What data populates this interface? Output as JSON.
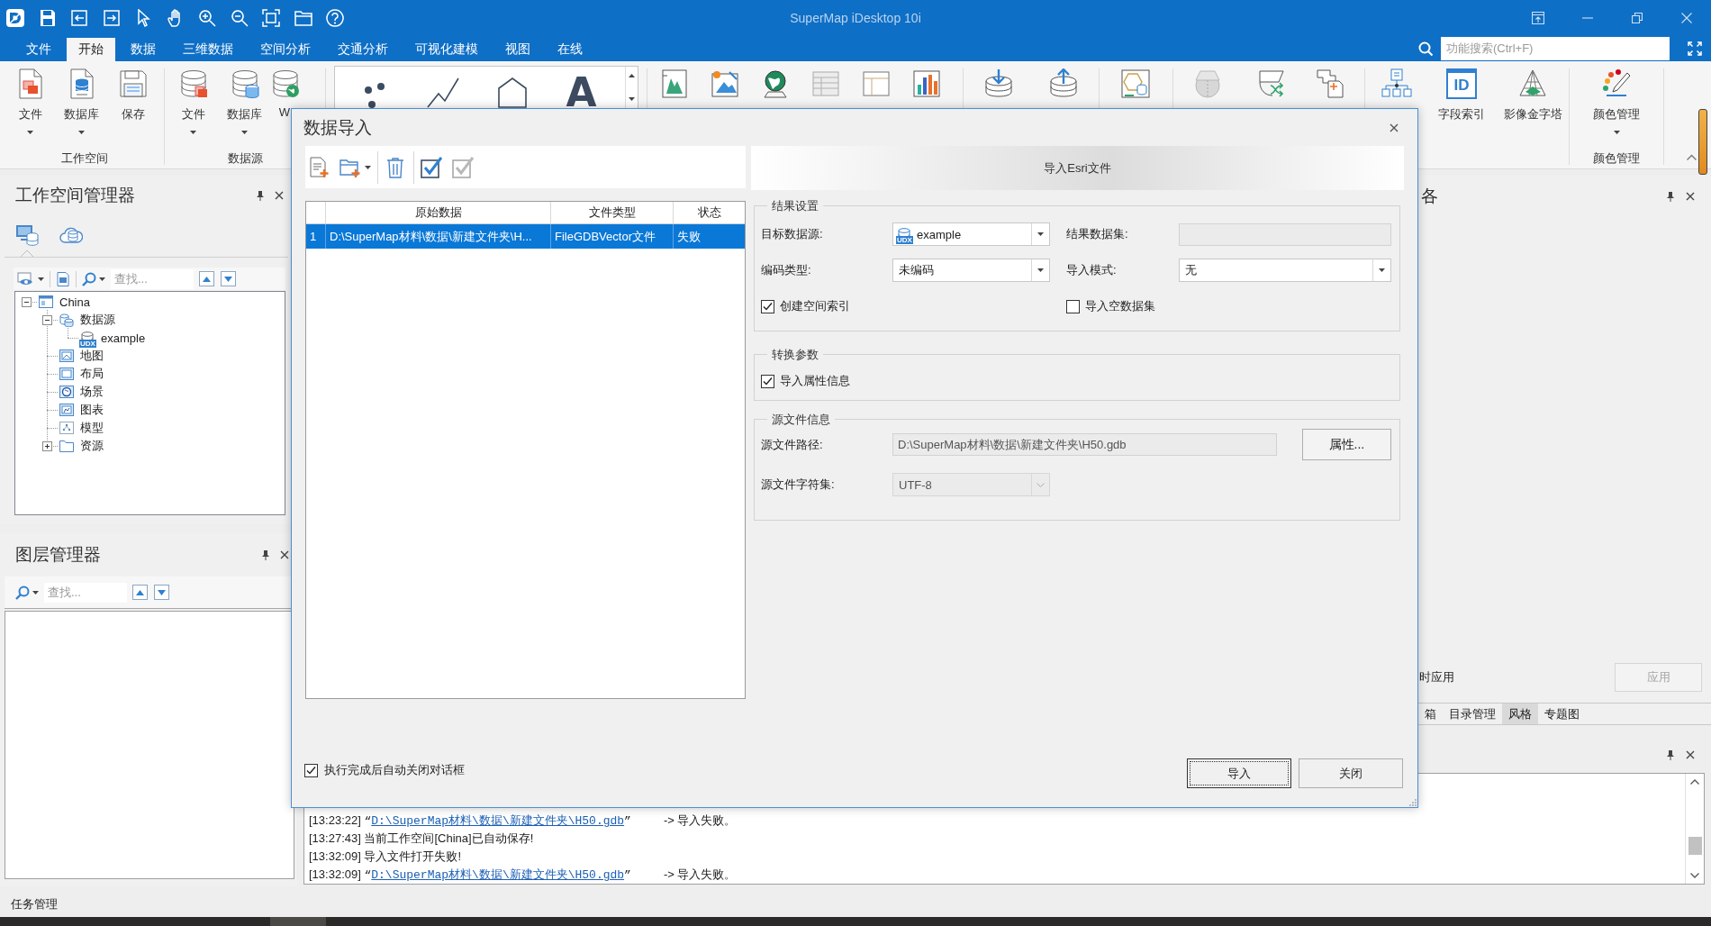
{
  "window": {
    "title": "SuperMap iDesktop 10i"
  },
  "menu_tabs": [
    {
      "label": "文件",
      "selected": false
    },
    {
      "label": "开始",
      "selected": true
    },
    {
      "label": "数据",
      "selected": false
    },
    {
      "label": "三维数据",
      "selected": false
    },
    {
      "label": "空间分析",
      "selected": false
    },
    {
      "label": "交通分析",
      "selected": false
    },
    {
      "label": "可视化建模",
      "selected": false
    },
    {
      "label": "视图",
      "selected": false
    },
    {
      "label": "在线",
      "selected": false
    }
  ],
  "search": {
    "placeholder": "功能搜索(Ctrl+F)"
  },
  "ribbon": {
    "groups": [
      {
        "label": "工作空间",
        "buttons": [
          {
            "label": "文件",
            "dropdown": true
          },
          {
            "label": "数据库",
            "dropdown": true
          },
          {
            "label": "保存",
            "dropdown": false
          }
        ]
      },
      {
        "label": "数据源",
        "buttons": [
          {
            "label": "文件",
            "dropdown": true
          },
          {
            "label": "数据库",
            "dropdown": true
          },
          {
            "label": "W",
            "dropdown": false
          }
        ]
      },
      {
        "buttons": [
          {
            "label": "字段索引",
            "icon_text": "ID",
            "dropdown": false
          },
          {
            "label": "影像金字塔",
            "dropdown": false
          }
        ]
      },
      {
        "label": "颜色管理",
        "buttons": [
          {
            "label": "颜色管理",
            "dropdown": true
          }
        ]
      }
    ],
    "gallery": {
      "glyph": "A"
    }
  },
  "workspace_manager": {
    "title": "工作空间管理器",
    "tabs": [
      {
        "selected": true
      },
      {
        "selected": false
      }
    ],
    "search": {
      "placeholder": "查找..."
    },
    "tree": [
      {
        "label": "China",
        "kind": "workspace",
        "expanded": true,
        "children": [
          {
            "label": "数据源",
            "kind": "datasources",
            "expanded": true,
            "children": [
              {
                "label": "example",
                "kind": "datasource",
                "icon_badge": "UDX"
              }
            ]
          },
          {
            "label": "地图",
            "kind": "maps"
          },
          {
            "label": "布局",
            "kind": "layouts"
          },
          {
            "label": "场景",
            "kind": "scenes"
          },
          {
            "label": "图表",
            "kind": "charts"
          },
          {
            "label": "模型",
            "kind": "models"
          },
          {
            "label": "资源",
            "kind": "resources",
            "expanded": false
          }
        ]
      }
    ]
  },
  "layer_manager": {
    "title": "图层管理器",
    "search": {
      "placeholder": "查找..."
    }
  },
  "right_panel": {
    "title": "各",
    "apply_label": "时应用",
    "apply_button": {
      "label": "应用",
      "disabled": true
    },
    "tabs": [
      {
        "label": "箱",
        "selected": false
      },
      {
        "label": "目录管理",
        "selected": false
      },
      {
        "label": "风格",
        "selected": true
      },
      {
        "label": "专题图",
        "selected": false
      }
    ]
  },
  "output": {
    "lines": [
      {
        "kind": "import_result",
        "time": "[13:23:22]",
        "quote_open": "“",
        "link": "D:\\SuperMap材料\\数据\\新建文件夹\\H50.gdb",
        "quote_close": "”",
        "result": "-> 导入失败。"
      },
      {
        "kind": "message",
        "time": "[13:27:43]",
        "message": "当前工作空间[China]已自动保存!"
      },
      {
        "kind": "message",
        "time": "[13:32:09]",
        "message": "导入文件打开失败!"
      },
      {
        "kind": "import_result",
        "time": "[13:32:09]",
        "quote_open": "“",
        "link": "D:\\SuperMap材料\\数据\\新建文件夹\\H50.gdb",
        "quote_close": "”",
        "result": "-> 导入失败。"
      }
    ]
  },
  "status_bar": {
    "text": "任务管理"
  },
  "dialog": {
    "title": "数据导入",
    "table": {
      "columns": [
        "原始数据",
        "文件类型",
        "状态"
      ],
      "rows": [
        {
          "number": "1",
          "cells": [
            "D:\\SuperMap材料\\数据\\新建文件夹\\H...",
            "FileGDBVector文件",
            "失败"
          ],
          "selected": true
        }
      ]
    },
    "panel_title": "导入Esri文件",
    "groups": [
      {
        "title": "结果设置",
        "fields": [
          {
            "kind": "dropdown",
            "label": "目标数据源:",
            "value": "example",
            "icon_badge": "UDX",
            "disabled": false
          },
          {
            "kind": "input",
            "label": "结果数据集:",
            "disabled": true
          },
          {
            "kind": "dropdown",
            "label": "编码类型:",
            "value": "未编码",
            "disabled": false
          },
          {
            "kind": "dropdown",
            "label": "导入模式:",
            "value": "无",
            "disabled": false
          },
          {
            "kind": "checkbox",
            "label": "创建空间索引",
            "checked": true
          },
          {
            "kind": "checkbox",
            "label": "导入空数据集",
            "checked": false
          }
        ]
      },
      {
        "title": "转换参数",
        "fields": [
          {
            "kind": "checkbox",
            "label": "导入属性信息",
            "checked": true
          }
        ]
      },
      {
        "title": "源文件信息",
        "fields": [
          {
            "kind": "path",
            "label": "源文件路径:",
            "value": "D:\\SuperMap材料\\数据\\新建文件夹\\H50.gdb",
            "button": "属性...",
            "disabled": true
          },
          {
            "kind": "dropdown",
            "label": "源文件字符集:",
            "value": "UTF-8",
            "disabled": true
          }
        ]
      }
    ],
    "auto_close": {
      "label": "执行完成后自动关闭对话框",
      "checked": true
    },
    "buttons": [
      {
        "label": "导入",
        "focused": true
      },
      {
        "label": "关闭",
        "focused": false
      }
    ]
  }
}
